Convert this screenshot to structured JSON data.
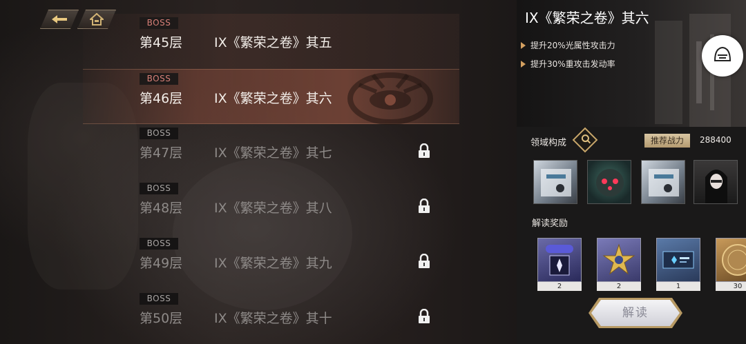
{
  "nav": {
    "back_icon": "back-arrow-icon",
    "home_icon": "home-icon"
  },
  "floors": [
    {
      "boss_tag": "BOSS",
      "floor": "第45层",
      "name": "IX《繁荣之卷》其五",
      "state": "cleared"
    },
    {
      "boss_tag": "BOSS",
      "floor": "第46层",
      "name": "IX《繁荣之卷》其六",
      "state": "selected"
    },
    {
      "boss_tag": "BOSS",
      "floor": "第47层",
      "name": "IX《繁荣之卷》其七",
      "state": "locked"
    },
    {
      "boss_tag": "BOSS",
      "floor": "第48层",
      "name": "IX《繁荣之卷》其八",
      "state": "locked"
    },
    {
      "boss_tag": "BOSS",
      "floor": "第49层",
      "name": "IX《繁荣之卷》其九",
      "state": "locked"
    },
    {
      "boss_tag": "BOSS",
      "floor": "第50层",
      "name": "IX《繁荣之卷》其十",
      "state": "locked"
    }
  ],
  "panel": {
    "title": "IX《繁荣之卷》其六",
    "buffs": [
      "提升20%光属性攻击力",
      "提升30%重攻击发动率"
    ],
    "domain_label": "领域构成",
    "power_label": "推荐战力",
    "power_value": "288400",
    "rewards_label": "解读奖励",
    "rewards": [
      {
        "icon": "ssr-ticket-icon",
        "qty": "2"
      },
      {
        "icon": "gold-star-icon",
        "qty": "2"
      },
      {
        "icon": "ticket-icon",
        "qty": "1"
      },
      {
        "icon": "coin-icon",
        "qty": "30"
      }
    ],
    "decode_button": "解读"
  },
  "colors": {
    "accent_gold": "#c8a66a",
    "boss_red": "#d88078",
    "selected_row": "#78463a"
  }
}
